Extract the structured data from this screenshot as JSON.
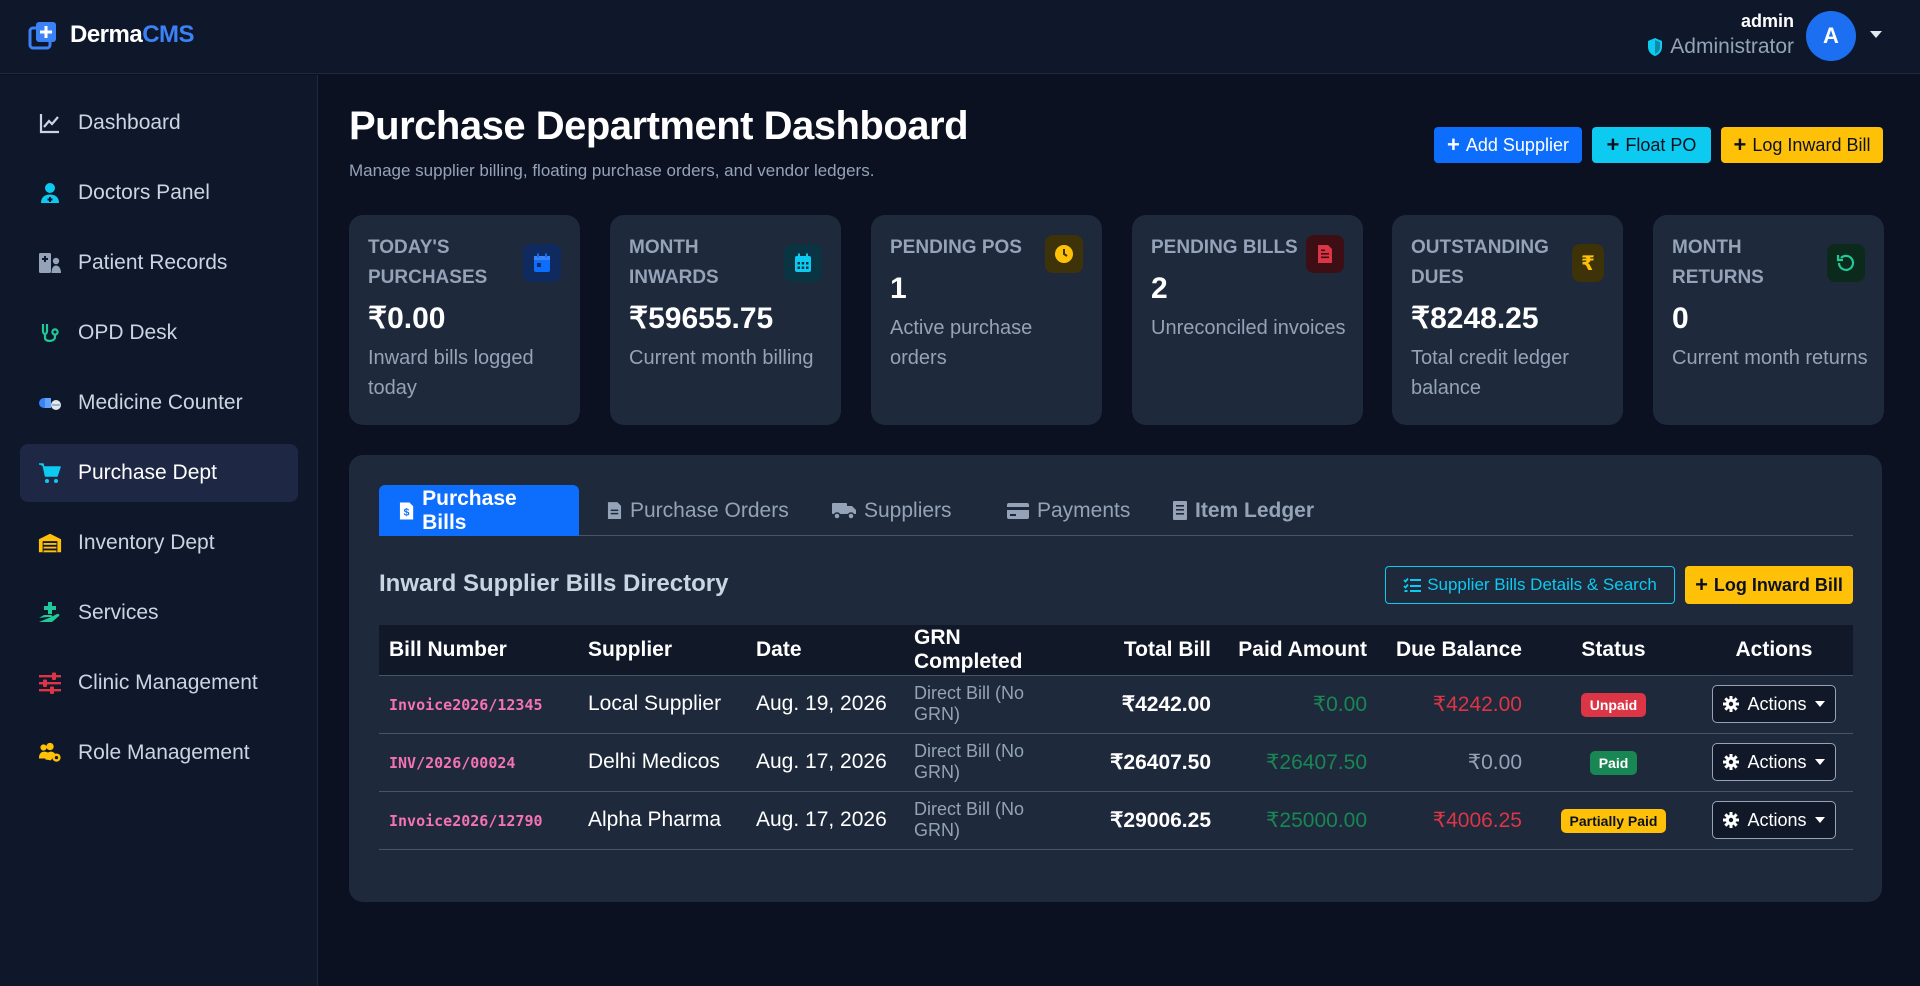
{
  "brand": {
    "part1": "Derma",
    "part2": "CMS"
  },
  "user": {
    "name": "admin",
    "role": "Administrator",
    "avatar_letter": "A"
  },
  "sidebar": {
    "items": [
      {
        "label": "Dashboard",
        "icon": "chart-line-icon"
      },
      {
        "label": "Doctors Panel",
        "icon": "user-doctor-icon"
      },
      {
        "label": "Patient Records",
        "icon": "hospital-user-icon"
      },
      {
        "label": "OPD Desk",
        "icon": "stethoscope-icon"
      },
      {
        "label": "Medicine Counter",
        "icon": "pills-icon"
      },
      {
        "label": "Purchase Dept",
        "icon": "cart-icon",
        "active": true
      },
      {
        "label": "Inventory Dept",
        "icon": "warehouse-icon"
      },
      {
        "label": "Services",
        "icon": "hand-holding-medical-icon"
      },
      {
        "label": "Clinic Management",
        "icon": "sliders-icon"
      },
      {
        "label": "Role Management",
        "icon": "users-gear-icon"
      }
    ]
  },
  "header": {
    "title": "Purchase Department Dashboard",
    "subtitle": "Manage supplier billing, floating purchase orders, and vendor ledgers.",
    "buttons": {
      "add_supplier": "Add Supplier",
      "float_po": "Float PO",
      "log_inward": "Log Inward Bill"
    }
  },
  "stats": [
    {
      "label": "TODAY'S PURCHASES",
      "value": "₹0.00",
      "desc": "Inward bills logged today",
      "icon": "calendar-day-icon",
      "color": "#0d6efd"
    },
    {
      "label": "MONTH INWARDS",
      "value": "₹59655.75",
      "desc": "Current month billing",
      "icon": "calendar-icon",
      "color": "#0dcaf0"
    },
    {
      "label": "PENDING POS",
      "value": "1",
      "desc": "Active purchase orders",
      "icon": "clock-icon",
      "color": "#ffc107"
    },
    {
      "label": "PENDING BILLS",
      "value": "2",
      "desc": "Unreconciled invoices",
      "icon": "file-invoice-icon",
      "color": "#dc3545"
    },
    {
      "label": "OUTSTANDING DUES",
      "value": "₹8248.25",
      "desc": "Total credit ledger balance",
      "icon": "rupee-icon",
      "color": "#ffc107"
    },
    {
      "label": "MONTH RETURNS",
      "value": "0",
      "desc": "Current month returns",
      "icon": "undo-icon",
      "color": "#198754"
    }
  ],
  "tabs": [
    {
      "label": "Purchase Bills",
      "icon": "file-invoice-dollar-icon"
    },
    {
      "label": "Purchase Orders",
      "icon": "file-icon"
    },
    {
      "label": "Suppliers",
      "icon": "truck-icon"
    },
    {
      "label": "Payments",
      "icon": "credit-card-icon"
    },
    {
      "label": "Item Ledger",
      "icon": "book-icon"
    }
  ],
  "section": {
    "title": "Inward Supplier Bills Directory",
    "details_button": "Supplier Bills Details & Search",
    "log_button": "Log Inward Bill"
  },
  "table": {
    "headers": [
      "Bill Number",
      "Supplier",
      "Date",
      "GRN Completed",
      "Total Bill",
      "Paid Amount",
      "Due Balance",
      "Status",
      "Actions"
    ],
    "action_label": "Actions",
    "rows": [
      {
        "bill": "Invoice2026/12345",
        "supplier": "Local Supplier",
        "date": "Aug. 19, 2026",
        "grn": "Direct Bill (No GRN)",
        "total": "₹4242.00",
        "paid": "₹0.00",
        "due": "₹4242.00",
        "status": "Unpaid"
      },
      {
        "bill": "INV/2026/00024",
        "supplier": "Delhi Medicos",
        "date": "Aug. 17, 2026",
        "grn": "Direct Bill (No GRN)",
        "total": "₹26407.50",
        "paid": "₹26407.50",
        "due": "₹0.00",
        "status": "Paid"
      },
      {
        "bill": "Invoice2026/12790",
        "supplier": "Alpha Pharma",
        "date": "Aug. 17, 2026",
        "grn": "Direct Bill (No GRN)",
        "total": "₹29006.25",
        "paid": "₹25000.00",
        "due": "₹4006.25",
        "status": "Partially Paid"
      }
    ]
  },
  "colors": {
    "accent": "#0d6efd",
    "success": "#198754",
    "danger": "#dc3545",
    "warning": "#ffc107",
    "info": "#0dcaf0"
  }
}
